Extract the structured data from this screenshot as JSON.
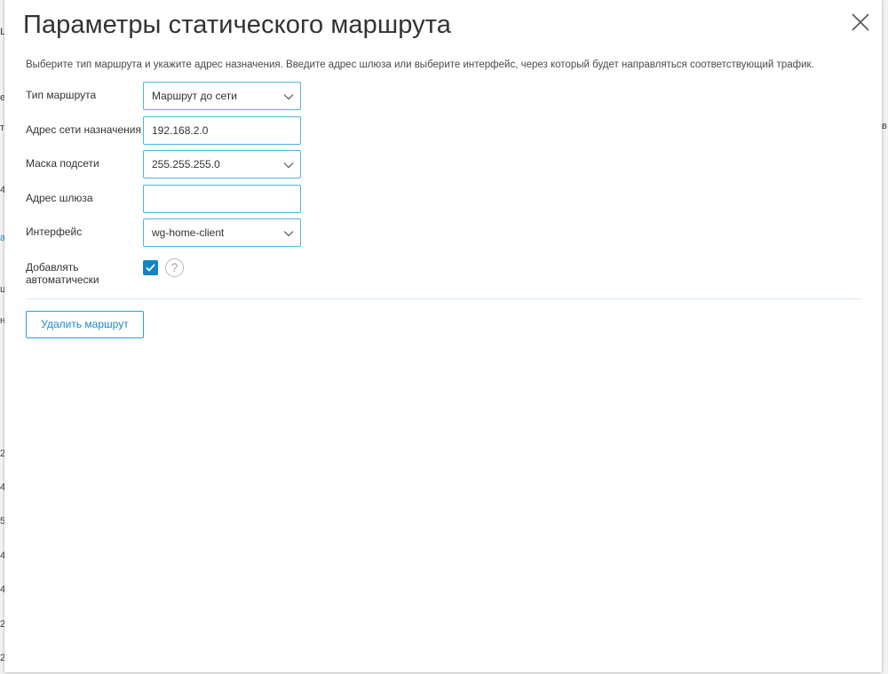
{
  "dialog": {
    "title": "Параметры статического маршрута",
    "hint": "Выберите тип маршрута и укажите адрес назначения. Введите адрес шлюза или выберите интерфейс, через который будет направляться соответствующий трафик.",
    "close_icon": "close-icon"
  },
  "form": {
    "route_type": {
      "label": "Тип маршрута",
      "value": "Маршрут до сети"
    },
    "destination": {
      "label": "Адрес сети назначения",
      "value": "192.168.2.0"
    },
    "mask": {
      "label": "Маска подсети",
      "value": "255.255.255.0"
    },
    "gateway": {
      "label": "Адрес шлюза",
      "value": ""
    },
    "interface": {
      "label": "Интерфейс",
      "value": "wg-home-client"
    },
    "auto_add": {
      "label_line1": "Добавлять",
      "label_line2": "автоматически",
      "checked": true
    }
  },
  "actions": {
    "delete_label": "Удалить маршрут"
  },
  "colors": {
    "accent": "#0f86c8",
    "border": "#4fb6df",
    "button_text": "#1a8cc8"
  },
  "background_edge": {
    "left_glyphs": [
      "ц",
      "е",
      "т",
      "4",
      "а",
      "ц",
      "н",
      "2",
      "4",
      "5",
      "4",
      "4",
      "2",
      "2"
    ],
    "right_glyphs": [
      "в"
    ]
  }
}
